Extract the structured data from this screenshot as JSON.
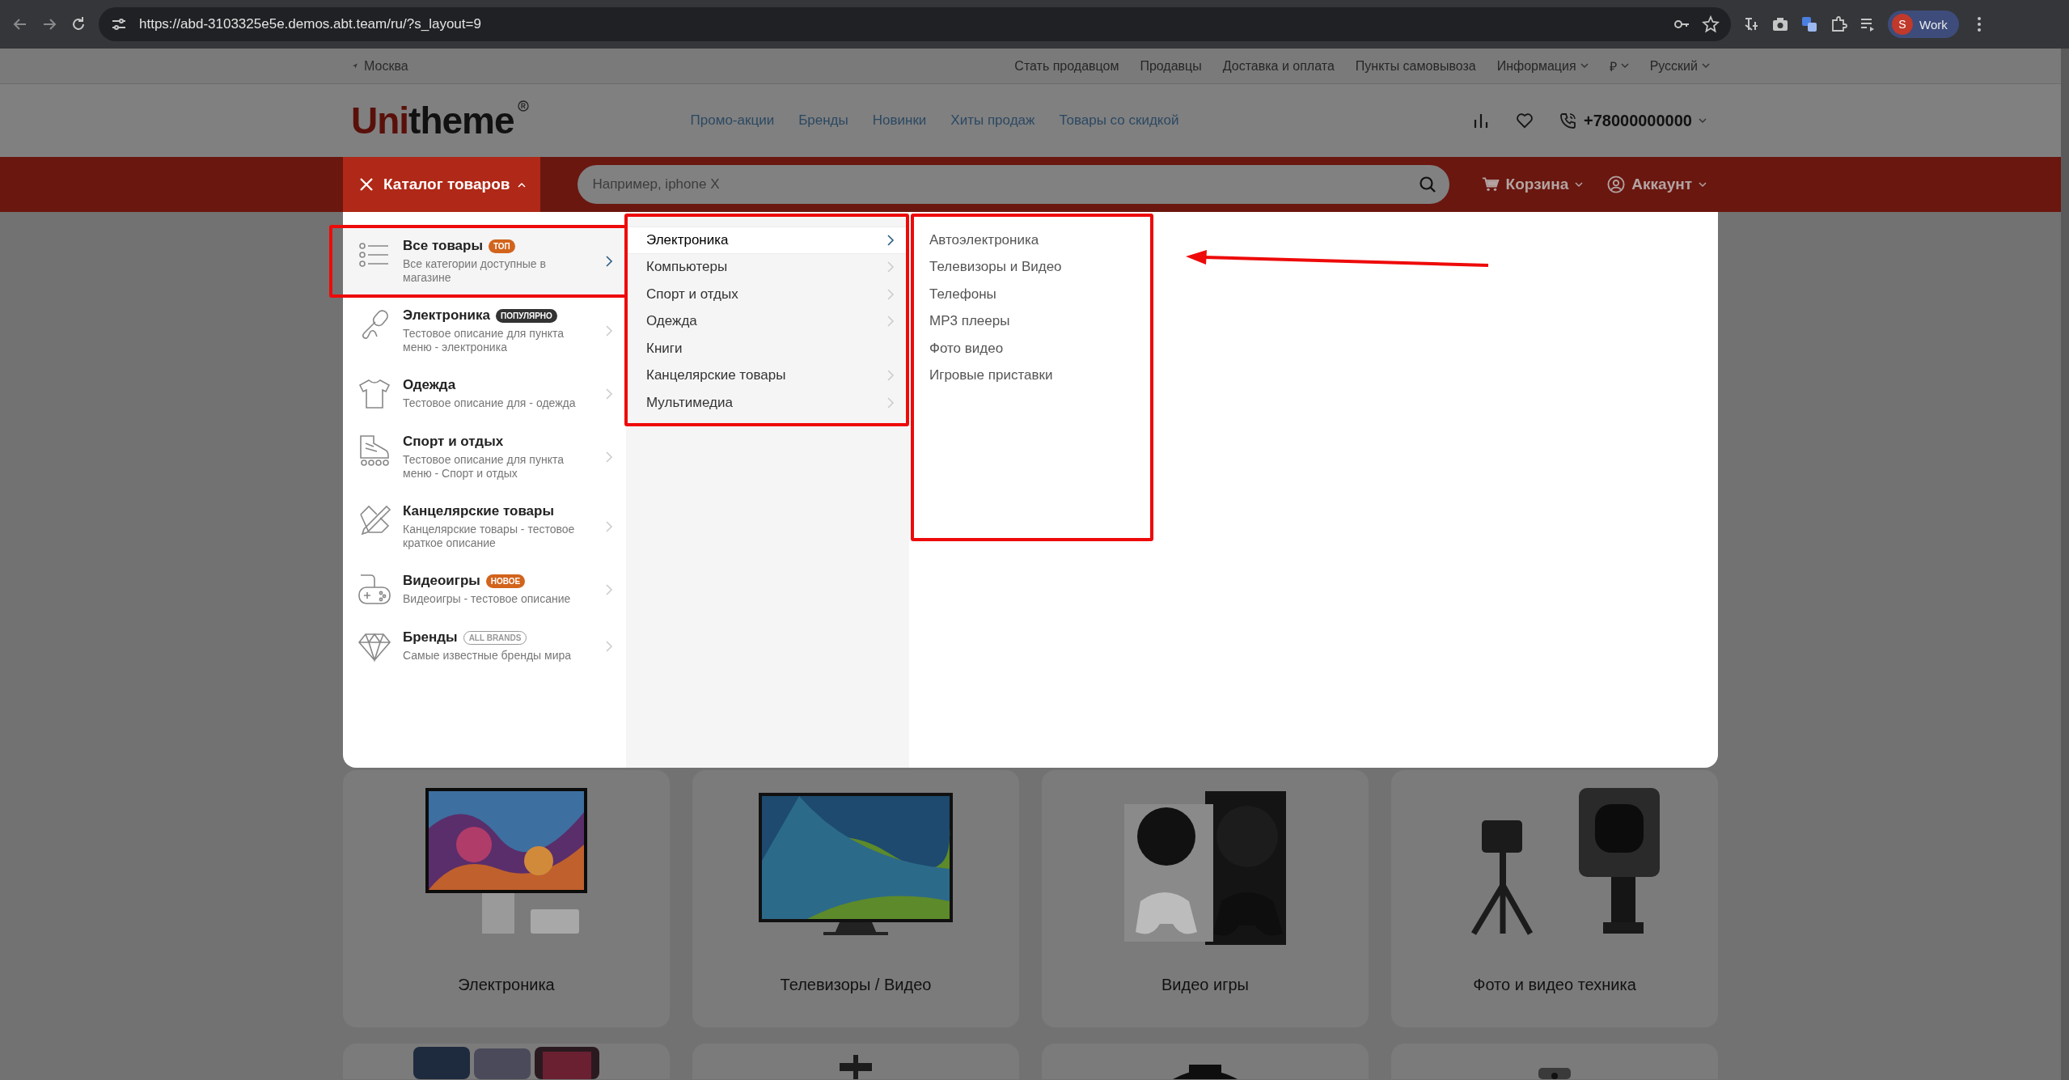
{
  "browser": {
    "url": "https://abd-3103325e5e.demos.abt.team/ru/?s_layout=9",
    "profile_initial": "S",
    "profile_name": "Work"
  },
  "top_bar": {
    "city": "Москва",
    "links": [
      {
        "label": "Стать продавцом",
        "dropdown": false
      },
      {
        "label": "Продавцы",
        "dropdown": false
      },
      {
        "label": "Доставка и оплата",
        "dropdown": false
      },
      {
        "label": "Пункты самовывоза",
        "dropdown": false
      },
      {
        "label": "Информация",
        "dropdown": true
      },
      {
        "label": "₽",
        "dropdown": true
      },
      {
        "label": "Русский",
        "dropdown": true
      }
    ]
  },
  "header": {
    "logo": "Unitheme",
    "nav": [
      "Промо-акции",
      "Бренды",
      "Новинки",
      "Хиты продаж",
      "Товары со скидкой"
    ],
    "phone": "+78000000000"
  },
  "search_bar": {
    "catalog_button": "Каталог товаров",
    "catalog_open": true,
    "placeholder": "Например, iphone X",
    "cart": "Корзина",
    "account": "Аккаунт"
  },
  "menu": {
    "categories": [
      {
        "title": "Все товары",
        "badge": {
          "text": "ТОП",
          "kind": "accent"
        },
        "description": "Все категории доступные в магазине",
        "selected": true
      },
      {
        "title": "Электроника",
        "badge": {
          "text": "ПОПУЛЯРНО",
          "kind": "dark"
        },
        "description": "Тестовое описание для пункта меню - электроника",
        "selected": false
      },
      {
        "title": "Одежда",
        "description": "Тестовое описание для - одежда",
        "selected": false
      },
      {
        "title": "Спорт и отдых",
        "description": "Тестовое описание для пункта меню - Спорт и отдых",
        "selected": false
      },
      {
        "title": "Канцелярские товары",
        "description": "Канцелярские товары - тестовое краткое описание",
        "selected": false
      },
      {
        "title": "Видеоигры",
        "badge": {
          "text": "НОВОЕ",
          "kind": "accent"
        },
        "description": "Видеоигры - тестовое описание",
        "selected": false
      },
      {
        "title": "Бренды",
        "badge": {
          "text": "ALL BRANDS",
          "kind": "outline"
        },
        "description": "Самые известные бренды мира",
        "selected": false
      }
    ],
    "subcategories": [
      {
        "label": "Электроника",
        "has_children": true,
        "selected": true
      },
      {
        "label": "Компьютеры",
        "has_children": true,
        "selected": false
      },
      {
        "label": "Спорт и отдых",
        "has_children": true,
        "selected": false
      },
      {
        "label": "Одежда",
        "has_children": true,
        "selected": false
      },
      {
        "label": "Книги",
        "has_children": false,
        "selected": false
      },
      {
        "label": "Канцелярские товары",
        "has_children": true,
        "selected": false
      },
      {
        "label": "Мультимедиа",
        "has_children": true,
        "selected": false
      }
    ],
    "items": [
      "Автоэлектроника",
      "Телевизоры и Видео",
      "Телефоны",
      "MP3 плееры",
      "Фото видео",
      "Игровые приставки"
    ]
  },
  "annotations": [
    {
      "kind": "frame"
    },
    {
      "kind": "frame"
    },
    {
      "kind": "frame"
    },
    {
      "kind": "arrow"
    }
  ],
  "cards": [
    {
      "title": "Электроника"
    },
    {
      "title": "Телевизоры / Видео"
    },
    {
      "title": "Видео игры"
    },
    {
      "title": "Фото и видео техника"
    }
  ]
}
